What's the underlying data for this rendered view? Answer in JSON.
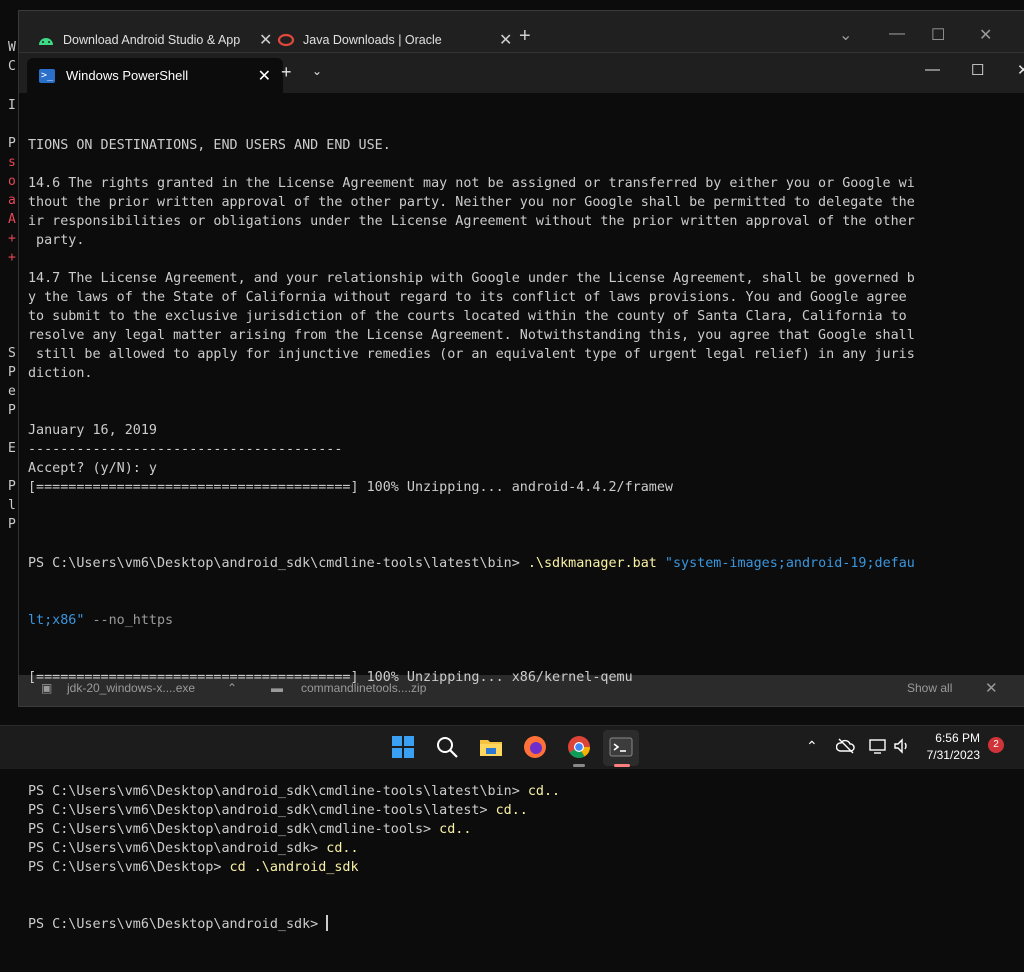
{
  "background_left": {
    "chars": [
      "W",
      "C",
      "I",
      "P",
      "s",
      "o",
      "a",
      "A",
      "+",
      "+",
      "S",
      "P",
      "e",
      "P",
      "E",
      "P",
      "l",
      "P"
    ]
  },
  "browser": {
    "tabs": [
      {
        "label": "Download Android Studio & App"
      },
      {
        "label": "Java Downloads | Oracle"
      }
    ],
    "new_tab": "+",
    "downloads": [
      {
        "label": "jdk-20_windows-x....exe"
      },
      {
        "label": "commandlinetools....zip"
      }
    ],
    "show_all": "Show all"
  },
  "terminal": {
    "tab_title": "Windows PowerShell",
    "lines": [
      "TIONS ON DESTINATIONS, END USERS AND END USE.",
      "",
      "14.6 The rights granted in the License Agreement may not be assigned or transferred by either you or Google wi",
      "thout the prior written approval of the other party. Neither you nor Google shall be permitted to delegate the",
      "ir responsibilities or obligations under the License Agreement without the prior written approval of the other",
      " party.",
      "",
      "14.7 The License Agreement, and your relationship with Google under the License Agreement, shall be governed b",
      "y the laws of the State of California without regard to its conflict of laws provisions. You and Google agree",
      "to submit to the exclusive jurisdiction of the courts located within the county of Santa Clara, California to",
      "resolve any legal matter arising from the License Agreement. Notwithstanding this, you agree that Google shall",
      " still be allowed to apply for injunctive remedies (or an equivalent type of urgent legal relief) in any juris",
      "diction.",
      "",
      "",
      "January 16, 2019",
      "---------------------------------------",
      "Accept? (y/N): y",
      "[=======================================] 100% Unzipping... android-4.4.2/framew",
      ""
    ],
    "sdk_cmd": {
      "prompt": "PS C:\\Users\\vm6\\Desktop\\android_sdk\\cmdline-tools\\latest\\bin> ",
      "command": ".\\sdkmanager.bat",
      "string1": "\"system-images;android-19;defau",
      "string2": "lt;x86\"",
      "param": " --no_https"
    },
    "progress2": "[=======================================] 100% Unzipping... x86/kernel-qemu",
    "cd_lines": [
      {
        "prompt": "PS C:\\Users\\vm6\\Desktop\\android_sdk\\cmdline-tools\\latest\\bin> ",
        "cmd": "cd.."
      },
      {
        "prompt": "PS C:\\Users\\vm6\\Desktop\\android_sdk\\cmdline-tools\\latest> ",
        "cmd": "cd.."
      },
      {
        "prompt": "PS C:\\Users\\vm6\\Desktop\\android_sdk\\cmdline-tools> ",
        "cmd": "cd.."
      },
      {
        "prompt": "PS C:\\Users\\vm6\\Desktop\\android_sdk> ",
        "cmd": "cd.."
      },
      {
        "prompt": "PS C:\\Users\\vm6\\Desktop> ",
        "cmd": "cd .\\android_sdk"
      }
    ],
    "current_prompt": "PS C:\\Users\\vm6\\Desktop\\android_sdk> "
  },
  "taskbar": {
    "time": "6:56 PM",
    "date": "7/31/2023",
    "notifications": "2"
  },
  "colors": {
    "terminal_bg": "#0c0c0c",
    "command": "#f9f1a5",
    "string": "#3a96dd",
    "parameter": "#9a9a9a",
    "text": "#cccccc"
  }
}
